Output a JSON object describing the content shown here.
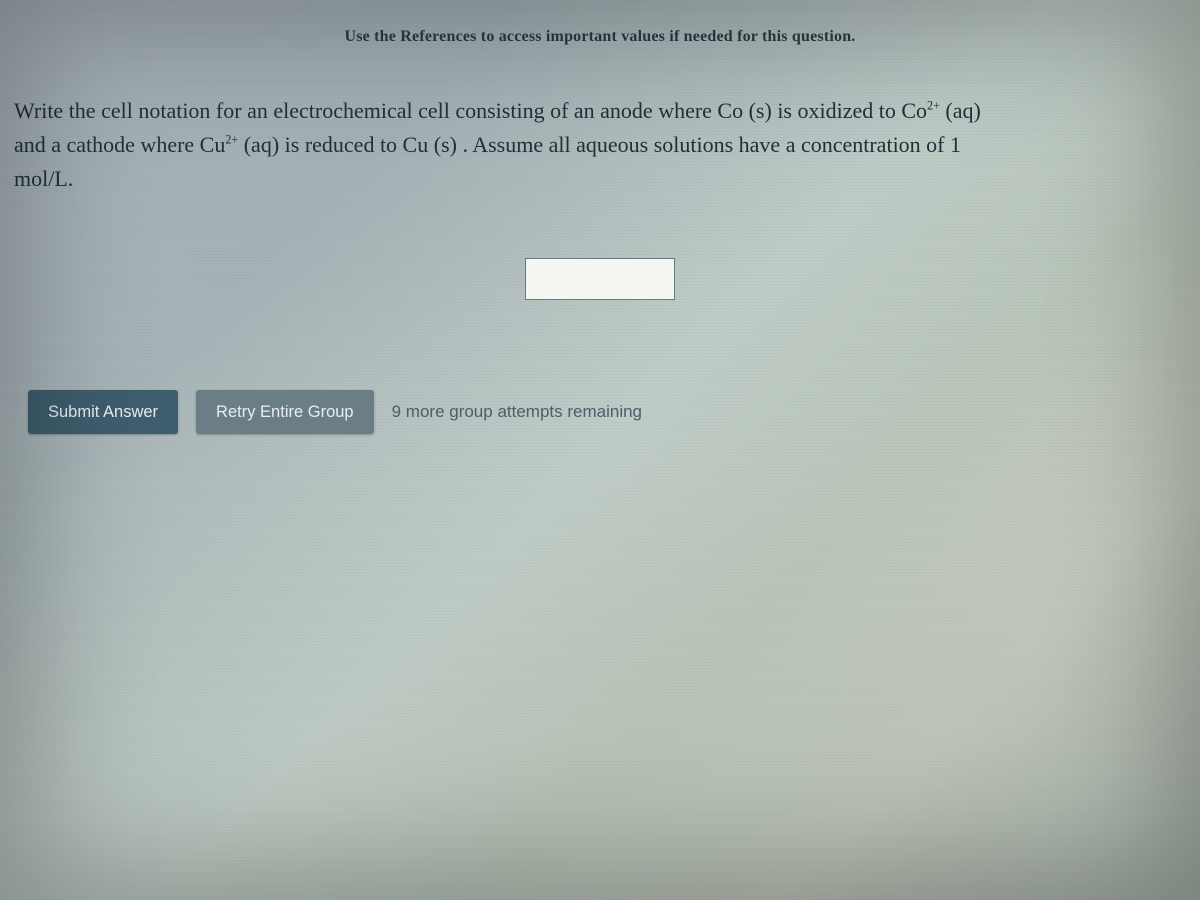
{
  "header": {
    "references_note": "Use the References to access important values if needed for this question."
  },
  "question": {
    "line1_a": "Write the cell notation for an electrochemical cell consisting of an anode where Co (s) is oxidized to Co",
    "line1_sup": "2+",
    "line1_b": " (aq)",
    "line2_a": "and a cathode where Cu",
    "line2_sup": "2+",
    "line2_b": " (aq) is reduced to Cu (s) . Assume all aqueous solutions have a concentration of 1",
    "line3": "mol/L."
  },
  "answer": {
    "value": ""
  },
  "buttons": {
    "submit": "Submit Answer",
    "retry": "Retry Entire Group"
  },
  "status": {
    "attempts": "9 more group attempts remaining"
  }
}
